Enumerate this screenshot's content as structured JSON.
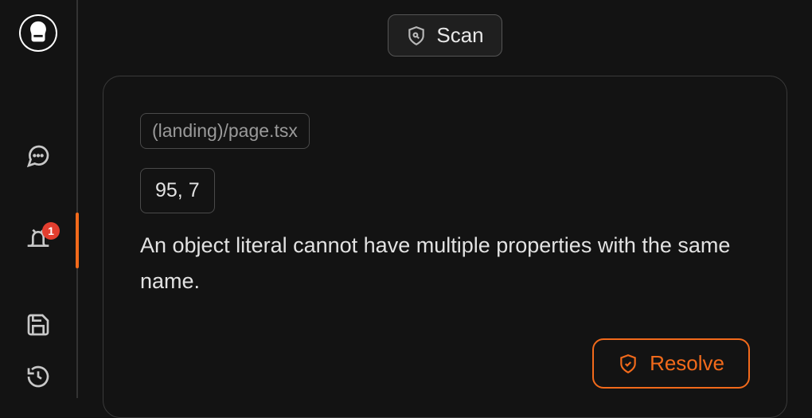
{
  "sidebar": {
    "alert_badge": "1"
  },
  "header": {
    "scan_label": "Scan"
  },
  "issue": {
    "file": "(landing)/page.tsx",
    "position": "95, 7",
    "message": "An object literal cannot have multiple properties with the same name.",
    "resolve_label": "Resolve"
  }
}
